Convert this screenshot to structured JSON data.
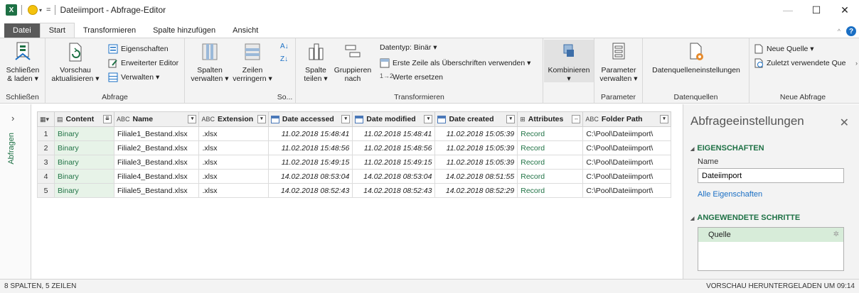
{
  "window": {
    "app_logo": "X",
    "title": "Dateiimport - Abfrage-Editor"
  },
  "tabs": [
    {
      "label": "Datei"
    },
    {
      "label": "Start"
    },
    {
      "label": "Transformieren"
    },
    {
      "label": "Spalte hinzufügen"
    },
    {
      "label": "Ansicht"
    }
  ],
  "ribbon": {
    "schliessen": {
      "btn_line1": "Schließen",
      "btn_line2": "& laden ▾",
      "group": "Schließen"
    },
    "abfrage": {
      "vorschau_line1": "Vorschau",
      "vorschau_line2": "aktualisieren ▾",
      "eigenschaften": "Eigenschaften",
      "erweiterter_editor": "Erweiterter Editor",
      "verwalten": "Verwalten ▾",
      "group": "Abfrage"
    },
    "spalten": {
      "line1": "Spalten",
      "line2": "verwalten ▾"
    },
    "zeilen": {
      "line1": "Zeilen",
      "line2": "verringern ▾"
    },
    "sortieren": {
      "group": "So..."
    },
    "transformieren": {
      "spalte_line1": "Spalte",
      "spalte_line2": "teilen ▾",
      "gruppieren_line1": "Gruppieren",
      "gruppieren_line2": "nach",
      "datentyp": "Datentyp: Binär ▾",
      "erste_zeile": "Erste Zeile als Überschriften verwenden ▾",
      "werte_ersetzen": "Werte ersetzen",
      "group": "Transformieren"
    },
    "kombinieren": {
      "line1": "Kombinieren",
      "line2": "▾"
    },
    "parameter": {
      "line1": "Parameter",
      "line2": "verwalten ▾",
      "group": "Parameter"
    },
    "datenquellen": {
      "label": "Datenquelleneinstellungen",
      "group": "Datenquellen"
    },
    "neue_abfrage": {
      "neue_quelle": "Neue Quelle ▾",
      "zuletzt": "Zuletzt verwendete Que",
      "group": "Neue Abfrage"
    }
  },
  "sidebar": {
    "label": "Abfragen"
  },
  "grid": {
    "columns": [
      {
        "label": "Content",
        "type": "binary"
      },
      {
        "label": "Name",
        "type": "text"
      },
      {
        "label": "Extension",
        "type": "text"
      },
      {
        "label": "Date accessed",
        "type": "datetime"
      },
      {
        "label": "Date modified",
        "type": "datetime"
      },
      {
        "label": "Date created",
        "type": "datetime"
      },
      {
        "label": "Attributes",
        "type": "record"
      },
      {
        "label": "Folder Path",
        "type": "text"
      }
    ],
    "rows": [
      {
        "n": "1",
        "content": "Binary",
        "name": "Filiale1_Bestand.xlsx",
        "ext": ".xlsx",
        "accessed": "11.02.2018 15:48:41",
        "modified": "11.02.2018 15:48:41",
        "created": "11.02.2018 15:05:39",
        "attributes": "Record",
        "folder": "C:\\Pool\\Dateiimport\\"
      },
      {
        "n": "2",
        "content": "Binary",
        "name": "Filiale2_Bestand.xlsx",
        "ext": ".xlsx",
        "accessed": "11.02.2018 15:48:56",
        "modified": "11.02.2018 15:48:56",
        "created": "11.02.2018 15:05:39",
        "attributes": "Record",
        "folder": "C:\\Pool\\Dateiimport\\"
      },
      {
        "n": "3",
        "content": "Binary",
        "name": "Filiale3_Bestand.xlsx",
        "ext": ".xlsx",
        "accessed": "11.02.2018 15:49:15",
        "modified": "11.02.2018 15:49:15",
        "created": "11.02.2018 15:05:39",
        "attributes": "Record",
        "folder": "C:\\Pool\\Dateiimport\\"
      },
      {
        "n": "4",
        "content": "Binary",
        "name": "Filiale4_Bestand.xlsx",
        "ext": ".xlsx",
        "accessed": "14.02.2018 08:53:04",
        "modified": "14.02.2018 08:53:04",
        "created": "14.02.2018 08:51:55",
        "attributes": "Record",
        "folder": "C:\\Pool\\Dateiimport\\"
      },
      {
        "n": "5",
        "content": "Binary",
        "name": "Filiale5_Bestand.xlsx",
        "ext": ".xlsx",
        "accessed": "14.02.2018 08:52:43",
        "modified": "14.02.2018 08:52:43",
        "created": "14.02.2018 08:52:29",
        "attributes": "Record",
        "folder": "C:\\Pool\\Dateiimport\\"
      }
    ]
  },
  "pane": {
    "title": "Abfrageeinstellungen",
    "eigenschaften_head": "EIGENSCHAFTEN",
    "name_label": "Name",
    "name_value": "Dateiimport",
    "alle_eigenschaften": "Alle Eigenschaften",
    "schritte_head": "ANGEWENDETE SCHRITTE",
    "steps": [
      {
        "label": "Quelle"
      }
    ]
  },
  "status": {
    "left": "8 SPALTEN, 5 ZEILEN",
    "right": "VORSCHAU HERUNTERGELADEN UM 09:14"
  },
  "colors": {
    "excel_green": "#1e7145",
    "record_green": "#217346",
    "link_blue": "#1a6fc4",
    "selected_step": "#d7ecd9"
  }
}
